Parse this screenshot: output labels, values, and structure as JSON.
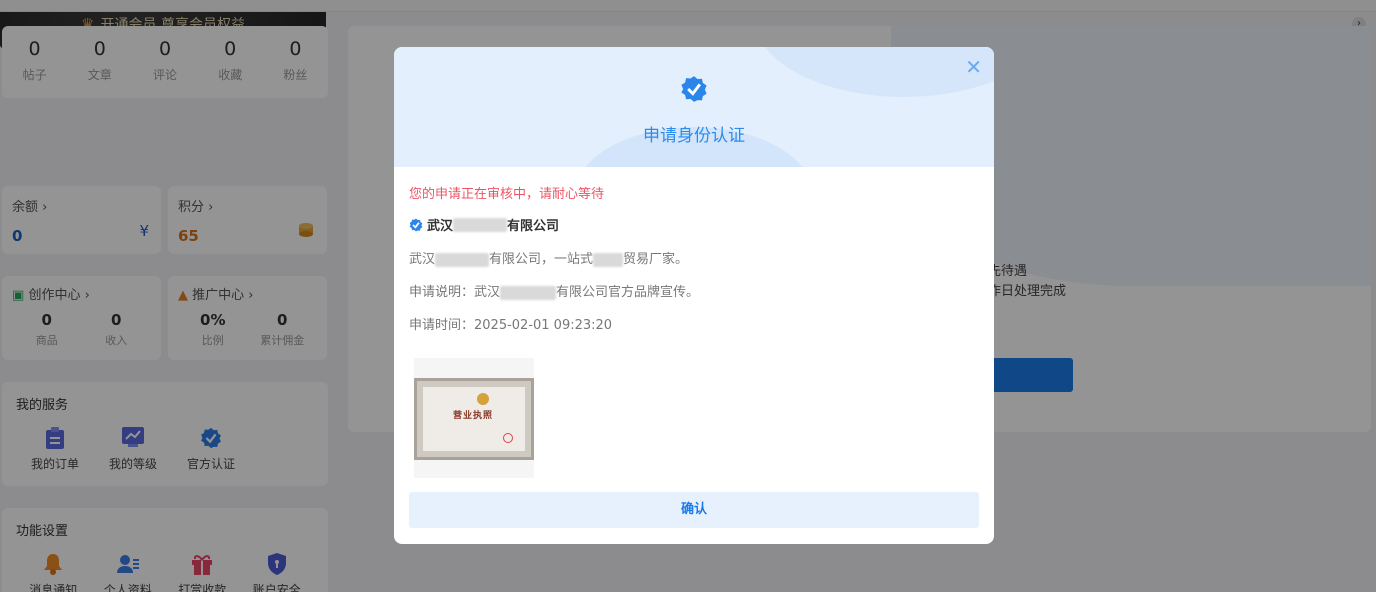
{
  "stats": [
    {
      "value": "0",
      "label": "帖子"
    },
    {
      "value": "0",
      "label": "文章"
    },
    {
      "value": "0",
      "label": "评论"
    },
    {
      "value": "0",
      "label": "收藏"
    },
    {
      "value": "0",
      "label": "粉丝"
    }
  ],
  "vip": {
    "crown": "♛",
    "label": "开通会员 尊享会员权益",
    "arrow": "›"
  },
  "balance": {
    "title": "余额 ›",
    "value": "0",
    "icon": "¥"
  },
  "points": {
    "title": "积分 ›",
    "value": "65",
    "icon": "coins-icon"
  },
  "creator": {
    "title": "创作中心 ›",
    "items": [
      {
        "value": "0",
        "label": "商品"
      },
      {
        "value": "0",
        "label": "收入"
      }
    ]
  },
  "promo": {
    "title": "推广中心 ›",
    "items": [
      {
        "value": "0%",
        "label": "比例"
      },
      {
        "value": "0",
        "label": "累计佣金"
      }
    ]
  },
  "services": {
    "title": "我的服务",
    "items": [
      {
        "label": "我的订单",
        "icon": "clipboard-icon"
      },
      {
        "label": "我的等级",
        "icon": "chart-icon"
      },
      {
        "label": "官方认证",
        "icon": "verified-icon"
      }
    ]
  },
  "settings": {
    "title": "功能设置",
    "items": [
      {
        "label": "消息通知",
        "icon": "bell-icon"
      },
      {
        "label": "个人资料",
        "icon": "user-icon"
      },
      {
        "label": "打赏收款",
        "icon": "gift-icon"
      },
      {
        "label": "账户安全",
        "icon": "shield-icon"
      }
    ]
  },
  "banner": {
    "line1": "先待遇",
    "line2": "作日处理完成"
  },
  "modal": {
    "title": "申请身份认证",
    "close": "✕",
    "pending": "您的申请正在审核中，请耐心等待",
    "company_a": "武汉",
    "company_b": "有限公司",
    "desc_a": "武汉",
    "desc_b": "有限公司，一站式",
    "desc_c": "贸易厂家。",
    "note_a": "申请说明：武汉",
    "note_b": "有限公司官方品牌宣传。",
    "time": "申请时间：2025-02-01 09:23:20",
    "license_title": "营业执照",
    "confirm": "确认"
  },
  "colors": {
    "accent": "#2b8bef",
    "pending": "#ee5466",
    "balance": "#1a5fc8",
    "points": "#d7731a"
  }
}
